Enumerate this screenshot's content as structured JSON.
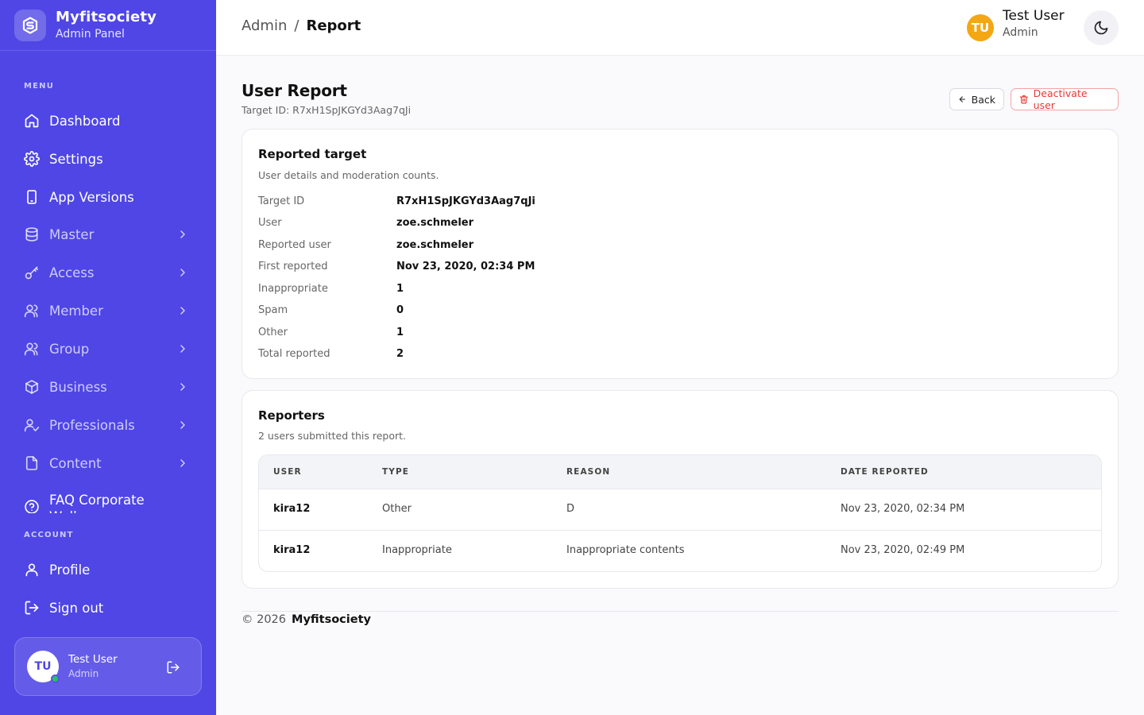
{
  "brand": {
    "name": "Myfitsociety",
    "subtitle": "Admin Panel"
  },
  "sidebar": {
    "menu_label": "MENU",
    "account_label": "ACCOUNT",
    "items": [
      {
        "label": "Dashboard",
        "icon": "home-icon"
      },
      {
        "label": "Settings",
        "icon": "gear-icon"
      },
      {
        "label": "App Versions",
        "icon": "phone-icon"
      },
      {
        "label": "Master",
        "icon": "database-icon"
      },
      {
        "label": "Access",
        "icon": "key-icon"
      },
      {
        "label": "Member",
        "icon": "users-icon"
      },
      {
        "label": "Group",
        "icon": "users-icon"
      },
      {
        "label": "Business",
        "icon": "box-icon"
      },
      {
        "label": "Professionals",
        "icon": "user-check-icon"
      },
      {
        "label": "Content",
        "icon": "file-icon"
      },
      {
        "label": "FAQ Corporate Wellness",
        "icon": "help-circle-icon"
      }
    ],
    "account_items": [
      {
        "label": "Profile",
        "icon": "user-icon"
      },
      {
        "label": "Sign out",
        "icon": "logout-icon"
      }
    ],
    "user_card": {
      "initials": "TU",
      "name": "Test User",
      "role": "Admin"
    }
  },
  "topbar": {
    "breadcrumb_root": "Admin",
    "breadcrumb_sep": "/",
    "breadcrumb_current": "Report",
    "avatar_initials": "TU",
    "user_name": "Test User",
    "user_role": "Admin"
  },
  "page": {
    "title": "User Report",
    "subtitle": "Target ID: R7xH1SpJKGYd3Aag7qJi",
    "back_label": "Back",
    "deactivate_label": "Deactivate user"
  },
  "target_card": {
    "title": "Reported target",
    "subtitle": "User details and moderation counts.",
    "rows": [
      {
        "label": "Target ID",
        "value": "R7xH1SpJKGYd3Aag7qJi"
      },
      {
        "label": "User",
        "value": "zoe.schmeler"
      },
      {
        "label": "Reported user",
        "value": "zoe.schmeler"
      },
      {
        "label": "First reported",
        "value": "Nov 23, 2020, 02:34 PM"
      },
      {
        "label": "Inappropriate",
        "value": "1"
      },
      {
        "label": "Spam",
        "value": "0"
      },
      {
        "label": "Other",
        "value": "1"
      },
      {
        "label": "Total reported",
        "value": "2"
      }
    ]
  },
  "reporters_card": {
    "title": "Reporters",
    "subtitle": "2 users submitted this report.",
    "columns": [
      "USER",
      "TYPE",
      "REASON",
      "DATE REPORTED"
    ],
    "rows": [
      {
        "user": "kira12",
        "type": "Other",
        "reason": "D",
        "date": "Nov 23, 2020, 02:34 PM"
      },
      {
        "user": "kira12",
        "type": "Inappropriate",
        "reason": "Inappropriate contents",
        "date": "Nov 23, 2020, 02:49 PM"
      }
    ]
  },
  "footer": {
    "copyright": "© 2026",
    "brand": "Myfitsociety"
  },
  "colors": {
    "sidebar": "#4f46e5",
    "avatar": "#f3a712",
    "danger": "#e53935",
    "online": "#22c55e"
  }
}
